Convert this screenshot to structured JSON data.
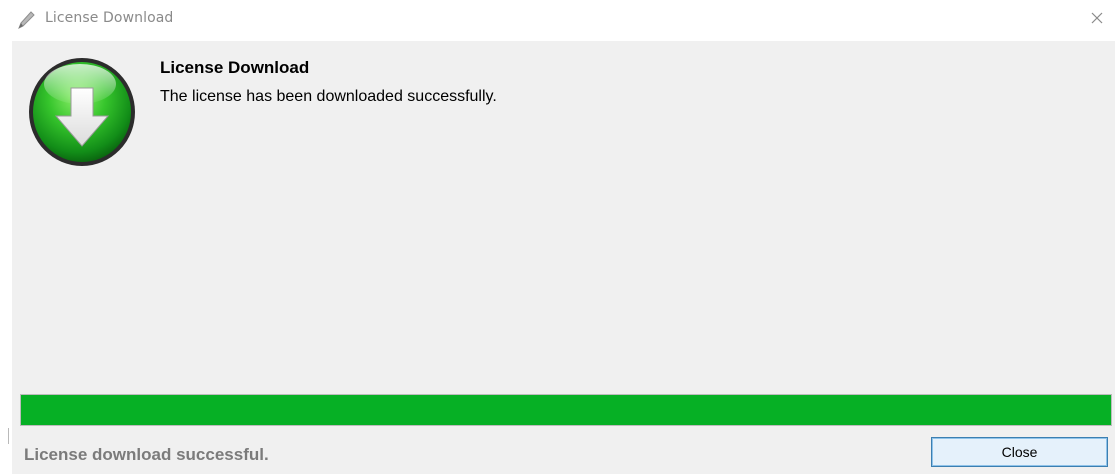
{
  "window": {
    "title": "License Download",
    "title_icon": "pencil-icon",
    "close_icon": "close-icon"
  },
  "content": {
    "icon": "download-arrow-icon",
    "heading": "License Download",
    "message": "The license has been downloaded successfully."
  },
  "progress": {
    "percent": 100,
    "color": "#06b025"
  },
  "status": {
    "text": "License download successful."
  },
  "buttons": {
    "close_label": "Close"
  },
  "colors": {
    "client_background": "#f0f0f0",
    "button_border": "#3c7fb1",
    "button_background": "#e5f1fb"
  }
}
